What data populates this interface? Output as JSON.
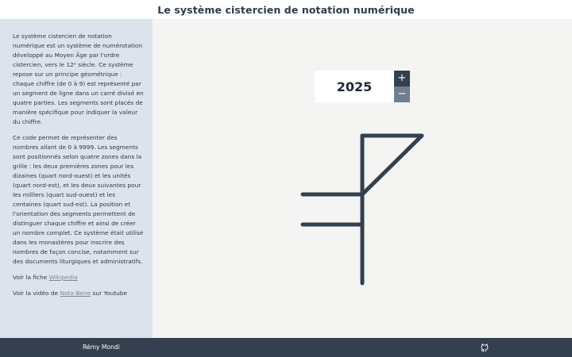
{
  "header": {
    "title": "Le système cistercien de notation numérique"
  },
  "sidebar": {
    "intro": "Le système cistercien de notation numérique est un système de numérotation développé au Moyen Âge par l'ordre cistercien, vers le 12ᵉ siècle. Ce système repose sur un principe géométrique : chaque chiffre (de 0 à 9) est représenté par un segment de ligne dans un carré divisé en quatre parties. Les segments sont placés de manière spécifique pour indiquer la valeur du chiffre.",
    "details": "Ce code permet de représenter des nombres allant de 0 à 9999. Les segments sont positionnés selon quatre zones dans la grille : les deux premières zones pour les dizaines (quart nord-ouest) et les unités (quart nord-est), et les deux suivantes pour les milliers (quart sud-ouest) et les centaines (quart sud-est). La position et l'orientation des segments permettent de distinguer chaque chiffre et ainsi de créer un nombre complet. Ce système était utilisé dans les monastères pour inscrire des nombres de façon concise, notamment sur des documents liturgiques et administratifs.",
    "wiki_prefix": "Voir la fiche ",
    "wiki_link": "Wikipedia",
    "video_prefix": "Voir la vidéo de ",
    "video_link": "Nota Bene",
    "video_suffix": " sur Youtube"
  },
  "counter": {
    "value": "2025",
    "increment_label": "+",
    "decrement_label": "−"
  },
  "footer": {
    "author": "Rémy Mondi",
    "icon": "github-icon"
  },
  "colors": {
    "ink": "#34404f",
    "sidebar_bg": "#dde3ec",
    "canvas_bg": "#f4f4f2"
  }
}
